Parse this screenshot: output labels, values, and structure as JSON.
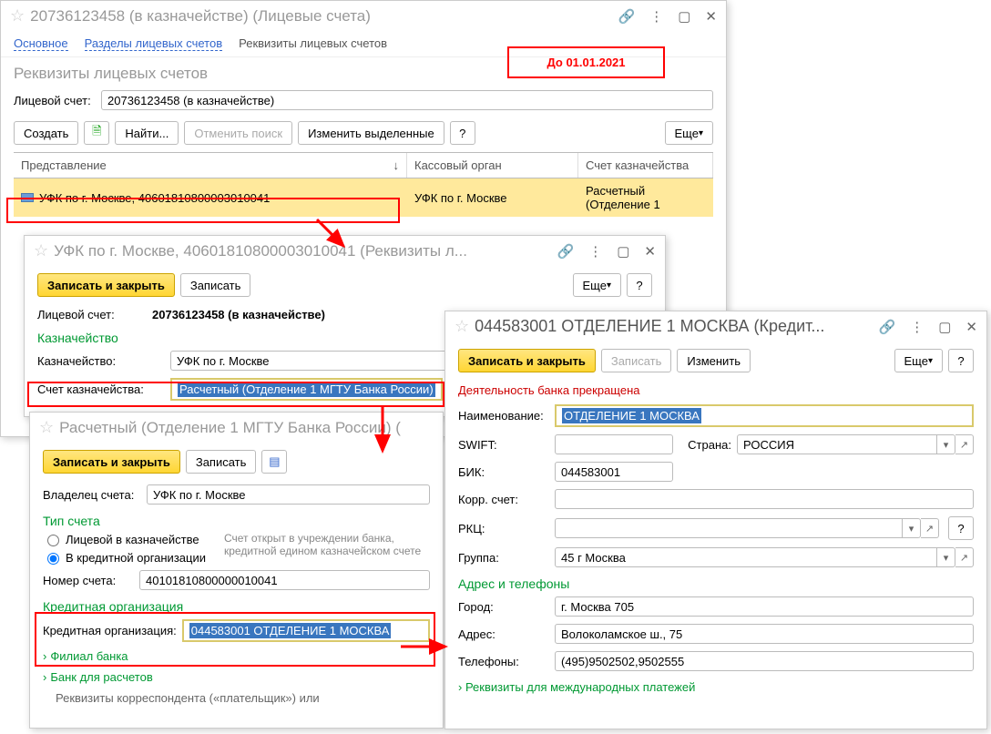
{
  "redNotice": "До 01.01.2021",
  "win1": {
    "title": "20736123458 (в казначействе) (Лицевые счета)",
    "tabs": {
      "t1": "Основное",
      "t2": "Разделы лицевых счетов",
      "t3": "Реквизиты лицевых счетов"
    },
    "sectionTitle": "Реквизиты лицевых счетов",
    "accountLabel": "Лицевой счет:",
    "accountVal": "20736123458 (в казначействе)",
    "btnCreate": "Создать",
    "btnFind": "Найти...",
    "btnCancel": "Отменить поиск",
    "btnChange": "Изменить выделенные",
    "btnMore": "Еще",
    "cols": {
      "c1": "Представление",
      "c2": "Кассовый орган",
      "c3": "Счет казначейства"
    },
    "row": {
      "v1": "УФК по г. Москве, 40601810800003010041",
      "v2": "УФК по г. Москве",
      "v3": "Расчетный (Отделение 1"
    }
  },
  "win2": {
    "title": "УФК по г. Москве, 40601810800003010041 (Реквизиты л...",
    "btnSaveClose": "Записать и закрыть",
    "btnSave": "Записать",
    "btnMore": "Еще",
    "accLabel": "Лицевой счет:",
    "accVal": "20736123458 (в казначействе)",
    "treasTitle": "Казначейство",
    "treasLabel": "Казначейство:",
    "treasVal": "УФК по г. Москве",
    "acctLabel": "Счет казначейства:",
    "acctVal": "Расчетный (Отделение 1 МГТУ Банка России)"
  },
  "win3": {
    "title": "Расчетный (Отделение 1 МГТУ Банка России) (",
    "btnSaveClose": "Записать и закрыть",
    "btnSave": "Записать",
    "ownerLabel": "Владелец счета:",
    "ownerVal": "УФК по г. Москве",
    "typeTitle": "Тип счета",
    "radio1": "Лицевой в казначействе",
    "radio2": "В кредитной организации",
    "hint": "Счет открыт в учреждении банка, кредитной едином казначейском счете",
    "numLabel": "Номер счета:",
    "numVal": "40101810800000010041",
    "orgTitle": "Кредитная организация",
    "orgLabel": "Кредитная организация:",
    "orgVal": "044583001 ОТДЕЛЕНИЕ 1 МОСКВА",
    "exp1": "Филиал банка",
    "exp2": "Банк для расчетов",
    "exp3": "Реквизиты корреспондента («плательщик») или"
  },
  "win4": {
    "title": "044583001 ОТДЕЛЕНИЕ 1 МОСКВА (Кредит...",
    "btnSaveClose": "Записать и закрыть",
    "btnSave": "Записать",
    "btnChange": "Изменить",
    "btnMore": "Еще",
    "status": "Деятельность банка прекращена",
    "nameLabel": "Наименование:",
    "nameVal": "ОТДЕЛЕНИЕ 1 МОСКВА",
    "swiftLabel": "SWIFT:",
    "countryLabel": "Страна:",
    "countryVal": "РОССИЯ",
    "bikLabel": "БИК:",
    "bikVal": "044583001",
    "corrLabel": "Корр. счет:",
    "rkcLabel": "РКЦ:",
    "groupLabel": "Группа:",
    "groupVal": "45 г Москва",
    "addrTitle": "Адрес и телефоны",
    "cityLabel": "Город:",
    "cityVal": "г. Москва 705",
    "addrLabel": "Адрес:",
    "addrVal": "Волоколамское ш., 75",
    "phoneLabel": "Телефоны:",
    "phoneVal": "(495)9502502,9502555",
    "intl": "Реквизиты для международных платежей"
  }
}
